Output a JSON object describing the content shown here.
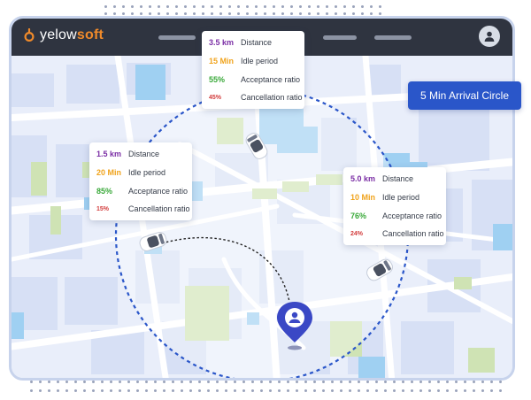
{
  "app": {
    "logo_prefix": "yelow",
    "logo_suffix": "soft"
  },
  "navbar": {
    "menu_items": 4,
    "profile_icon": "user-icon"
  },
  "arrival_circle": {
    "label": "5 Min Arrival Circle"
  },
  "drivers": [
    {
      "id": "top",
      "distance": "3.5 km",
      "idle": "15 Min",
      "acceptance": "55%",
      "cancellation": "45%"
    },
    {
      "id": "left",
      "distance": "1.5 km",
      "idle": "20 Min",
      "acceptance": "85%",
      "cancellation": "15%"
    },
    {
      "id": "right",
      "distance": "5.0 km",
      "idle": "10 Min",
      "acceptance": "76%",
      "cancellation": "24%"
    }
  ],
  "labels": {
    "distance": "Distance",
    "idle": "Idle period",
    "acceptance": "Acceptance ratio",
    "cancellation": "Cancellation ratio"
  },
  "colors": {
    "distance": "#7b2fa5",
    "idle": "#f0a31c",
    "acceptance": "#3aa93a",
    "cancellation": "#d23b3b",
    "circle": "#2a56c9",
    "navbar": "#2f3440",
    "brand_orange": "#f08a2a"
  }
}
